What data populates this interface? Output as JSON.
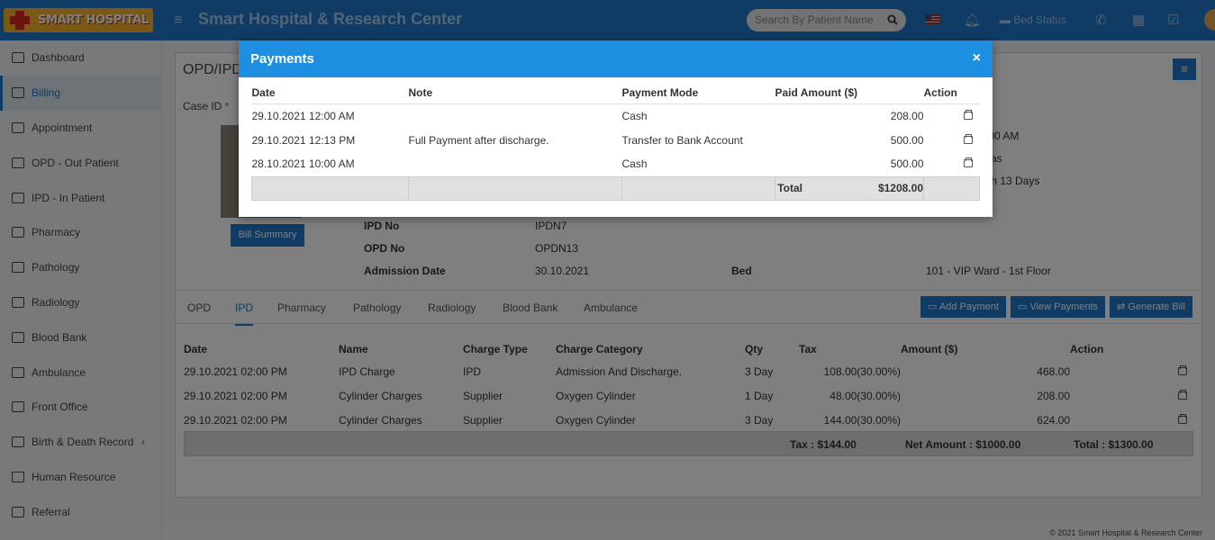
{
  "app": {
    "logo_text": "SMART HOSPITAL",
    "title": "Smart Hospital & Research Center",
    "search_placeholder": "Search By Patient Name",
    "bed_status": "Bed Status"
  },
  "sidebar": {
    "items": [
      {
        "label": "Dashboard",
        "icon": "monitor-icon"
      },
      {
        "label": "Billing",
        "icon": "file-icon"
      },
      {
        "label": "Appointment",
        "icon": "calendar-icon"
      },
      {
        "label": "OPD - Out Patient",
        "icon": "stethoscope-icon"
      },
      {
        "label": "IPD - In Patient",
        "icon": "bed-icon"
      },
      {
        "label": "Pharmacy",
        "icon": "mortar-icon"
      },
      {
        "label": "Pathology",
        "icon": "flask-icon"
      },
      {
        "label": "Radiology",
        "icon": "microscope-icon"
      },
      {
        "label": "Blood Bank",
        "icon": "drop-icon"
      },
      {
        "label": "Ambulance",
        "icon": "truck-icon"
      },
      {
        "label": "Front Office",
        "icon": "building-icon"
      },
      {
        "label": "Birth & Death Record",
        "icon": "family-icon"
      },
      {
        "label": "Human Resource",
        "icon": "sitemap-icon"
      },
      {
        "label": "Referral",
        "icon": "users-icon"
      }
    ]
  },
  "page": {
    "heading": "OPD/IPD",
    "case_id_label": "Case ID",
    "bill_summary": "Bill Summary",
    "info": {
      "ipd_no_label": "IPD No",
      "ipd_no": "IPDN7",
      "opd_no_label": "OPD No",
      "opd_no": "OPDN13",
      "admission_label": "Admission Date",
      "admission": "30.10.2021",
      "bed_label": "Bed",
      "bed": "101 - VIP Ward - 1st Floor",
      "partial_time": ":00 AM",
      "partial_2": "as",
      "partial_3": "th 13 Days"
    },
    "tabs": [
      "OPD",
      "IPD",
      "Pharmacy",
      "Pathology",
      "Radiology",
      "Blood Bank",
      "Ambulance"
    ],
    "actions": {
      "add_payment": "Add Payment",
      "view_payments": "View Payments",
      "generate_bill": "Generate Bill"
    },
    "charges": {
      "headers": [
        "Date",
        "Name",
        "Charge Type",
        "Charge Category",
        "Qty",
        "Tax",
        "Amount ($)",
        "Action"
      ],
      "rows": [
        [
          "29.10.2021 02:00 PM",
          "IPD Charge",
          "IPD",
          "Admission And Discharge.",
          "3 Day",
          "108.00(30.00%)",
          "468.00"
        ],
        [
          "29.10.2021 02:00 PM",
          "Cylinder Charges",
          "Supplier",
          "Oxygen Cylinder",
          "1 Day",
          "48.00(30.00%)",
          "208.00"
        ],
        [
          "29.10.2021 02:00 PM",
          "Cylinder Charges",
          "Supplier",
          "Oxygen Cylinder",
          "3 Day",
          "144.00(30.00%)",
          "624.00"
        ]
      ],
      "tax_total": "Tax : $144.00",
      "net_amount": "Net Amount : $1000.00",
      "total": "Total : $1300.00"
    }
  },
  "modal": {
    "title": "Payments",
    "close": "×",
    "headers": [
      "Date",
      "Note",
      "Payment Mode",
      "Paid Amount ($)",
      "Action"
    ],
    "rows": [
      [
        "29.10.2021 12:00 AM",
        "",
        "Cash",
        "208.00"
      ],
      [
        "29.10.2021 12:13 PM",
        "Full Payment after discharge.",
        "Transfer to Bank Account",
        "500.00"
      ],
      [
        "28.10.2021 10:00 AM",
        "",
        "Cash",
        "500.00"
      ]
    ],
    "total_label": "Total",
    "total_value": "$1208.00"
  },
  "footer": "© 2021 Smart Hospital & Research Center"
}
